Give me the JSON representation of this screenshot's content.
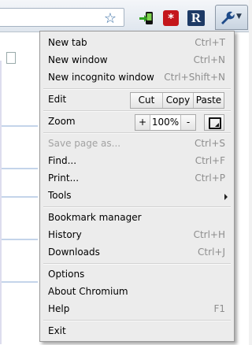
{
  "toolbar": {
    "star_glyph": "☆",
    "icons": [
      "bookmark-star-icon",
      "phone-extension-icon",
      "lastpass-icon",
      "r-extension-icon",
      "wrench-icon"
    ],
    "lastpass_glyph": "*",
    "r_glyph": "R"
  },
  "menu": {
    "new_tab": {
      "label": "New tab",
      "shortcut": "Ctrl+T"
    },
    "new_window": {
      "label": "New window",
      "shortcut": "Ctrl+N"
    },
    "new_incognito": {
      "label": "New incognito window",
      "shortcut": "Ctrl+Shift+N"
    },
    "edit": {
      "label": "Edit",
      "cut": "Cut",
      "copy": "Copy",
      "paste": "Paste"
    },
    "zoom": {
      "label": "Zoom",
      "minus": "-",
      "value": "100%",
      "plus": "+"
    },
    "save_page": {
      "label": "Save page as...",
      "shortcut": "Ctrl+S"
    },
    "find": {
      "label": "Find...",
      "shortcut": "Ctrl+F"
    },
    "print": {
      "label": "Print...",
      "shortcut": "Ctrl+P"
    },
    "tools": {
      "label": "Tools"
    },
    "bookmark_manager": {
      "label": "Bookmark manager"
    },
    "history": {
      "label": "History",
      "shortcut": "Ctrl+H"
    },
    "downloads": {
      "label": "Downloads",
      "shortcut": "Ctrl+J"
    },
    "options": {
      "label": "Options"
    },
    "about": {
      "label": "About Chromium"
    },
    "help": {
      "label": "Help",
      "shortcut": "F1"
    },
    "exit": {
      "label": "Exit"
    }
  }
}
